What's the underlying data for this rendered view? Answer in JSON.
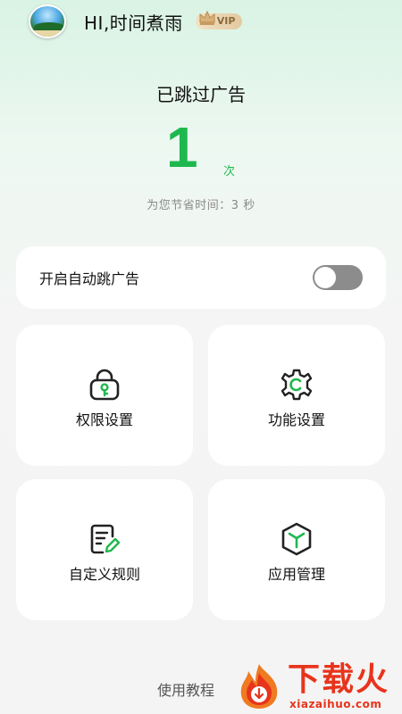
{
  "header": {
    "greeting": "HI,时间煮雨",
    "vip_badge": "VIP"
  },
  "stats": {
    "title": "已跳过广告",
    "count": "1",
    "unit": "次",
    "saved_time": "为您节省时间：3 秒"
  },
  "auto_skip": {
    "label": "开启自动跳广告",
    "enabled": false
  },
  "grid": {
    "permission": {
      "label": "权限设置",
      "icon": "lock-key-icon"
    },
    "function": {
      "label": "功能设置",
      "icon": "gear-icon"
    },
    "custom_rules": {
      "label": "自定义规则",
      "icon": "edit-document-icon"
    },
    "app_manage": {
      "label": "应用管理",
      "icon": "cube-icon"
    }
  },
  "footer": {
    "tutorial": "使用教程"
  },
  "watermark": {
    "brand": "下载火",
    "url": "xiazaihuo.com"
  },
  "colors": {
    "accent": "#1fb84e",
    "watermark": "#e8341c",
    "switch_off": "#8c8c8c"
  }
}
